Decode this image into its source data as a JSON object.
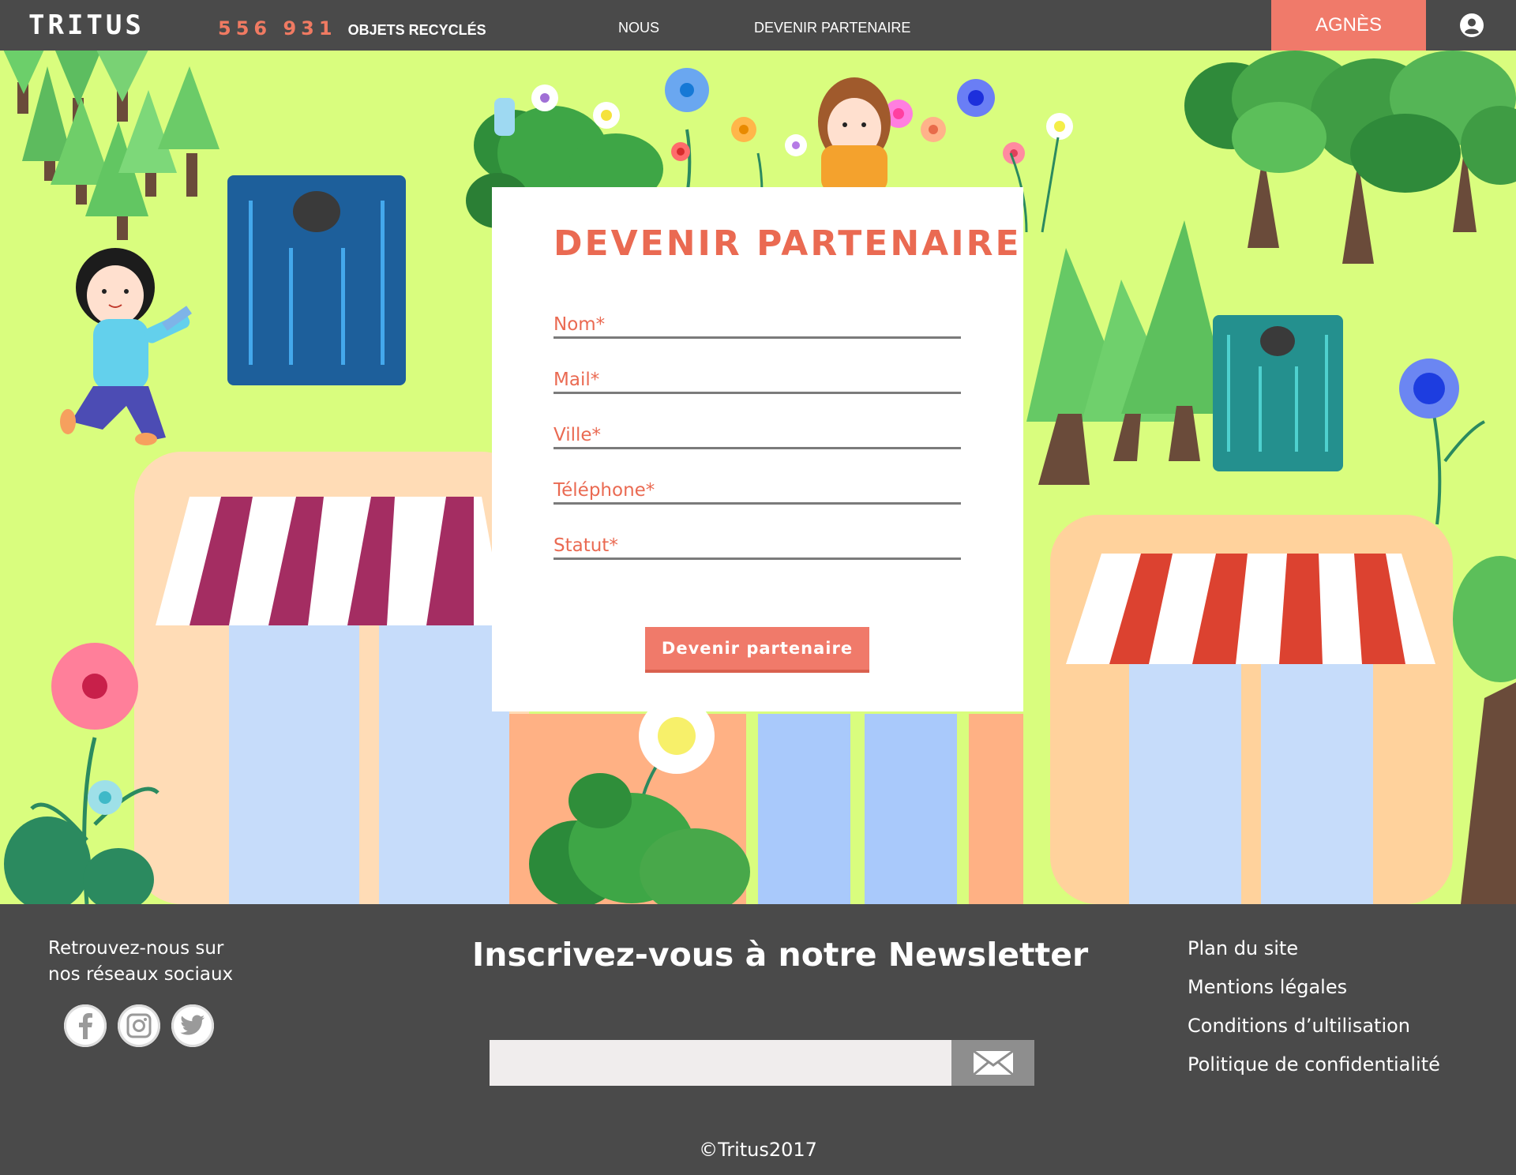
{
  "header": {
    "logo_text": "TRITUS",
    "counter_value": "556 931",
    "counter_label": "OBJETS RECYCLÉS",
    "nav": [
      {
        "label": "NOUS"
      },
      {
        "label": "DEVENIR PARTENAIRE"
      }
    ],
    "user_name": "AGNÈS",
    "account_icon": "user-circle-icon"
  },
  "form": {
    "title": "DEVENIR PARTENAIRE",
    "fields": [
      {
        "label": "Nom*"
      },
      {
        "label": "Mail*"
      },
      {
        "label": "Ville*"
      },
      {
        "label": "Téléphone*"
      },
      {
        "label": "Statut*"
      }
    ],
    "submit_label": "Devenir partenaire"
  },
  "footer": {
    "social_title_line1": "Retrouvez-nous sur",
    "social_title_line2": "nos réseaux sociaux",
    "social": [
      {
        "icon": "facebook-icon"
      },
      {
        "icon": "instagram-icon"
      },
      {
        "icon": "twitter-icon"
      }
    ],
    "newsletter_title": "Inscrivez-vous à notre Newsletter",
    "newsletter_send_icon": "envelope-icon",
    "links": [
      {
        "label": "Plan du site"
      },
      {
        "label": "Mentions légales"
      },
      {
        "label": "Conditions d’ultilisation"
      },
      {
        "label": "Politique de confidentialité"
      }
    ],
    "copyright": "©Tritus2017"
  },
  "colors": {
    "accent": "#f07a6a",
    "title": "#ea6a52",
    "dark_bg": "#4a4a4a",
    "hero_bg": "#d9fd7e"
  }
}
